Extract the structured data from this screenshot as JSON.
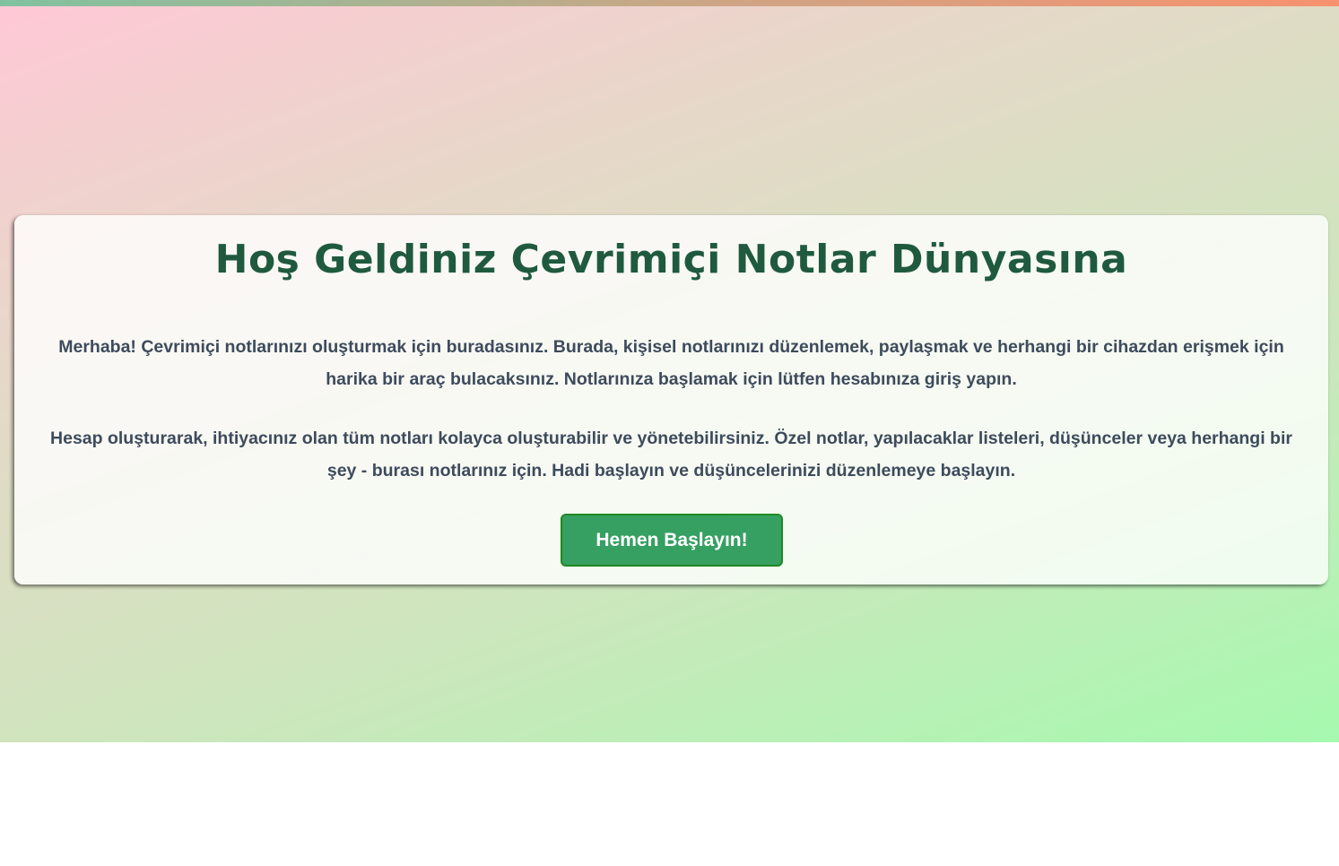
{
  "hero": {
    "title": "Hoş Geldiniz Çevrimiçi Notlar Dünyasına",
    "paragraph_1": "Merhaba! Çevrimiçi notlarınızı oluşturmak için buradasınız. Burada, kişisel notlarınızı düzenlemek, paylaşmak ve herhangi bir cihazdan erişmek için harika bir araç bulacaksınız. Notlarınıza başlamak için lütfen hesabınıza giriş yapın.",
    "paragraph_2": "Hesap oluşturarak, ihtiyacınız olan tüm notları kolayca oluşturabilir ve yönetebilirsiniz. Özel notlar, yapılacaklar listeleri, düşünceler veya herhangi bir şey - burası notlarınız için. Hadi başlayın ve düşüncelerinizi düzenlemeye başlayın.",
    "cta_label": "Hemen Başlayın!"
  },
  "colors": {
    "title": "#1f5a3e",
    "text": "#3d4b5c",
    "button": "#36a062",
    "button_border": "#1f8a1f",
    "gradient_start": "#ffc8d6",
    "gradient_end": "#a6f9af",
    "top_bar_start": "#80c2a0",
    "top_bar_end": "#f7916e"
  }
}
